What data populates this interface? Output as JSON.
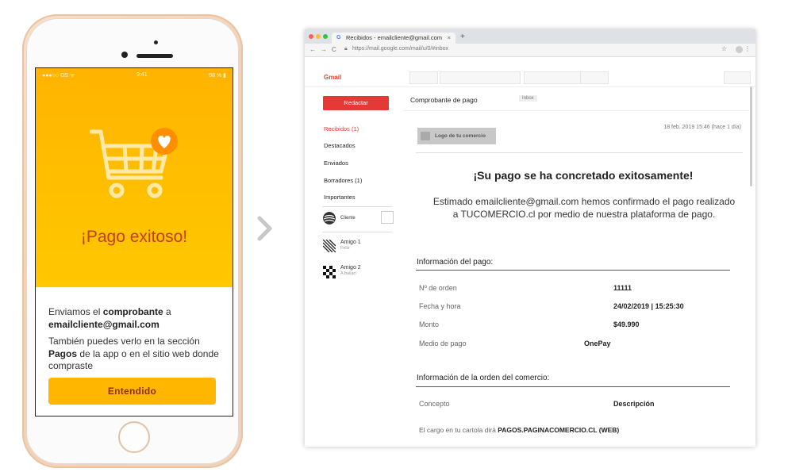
{
  "phone": {
    "status_left": "●●●○○ OS ᯤ",
    "status_time": "9:41",
    "status_right": "58 % ▮",
    "title": "¡Pago exitoso!",
    "msg_line1_pre": "Enviamos el ",
    "msg_line1_bold": "comprobante",
    "msg_line1_post": " a",
    "msg_email": "emailcliente@gmail.com",
    "msg2_pre": "También puedes verlo en la  sección ",
    "msg2_bold": "Pagos",
    "msg2_post": " de la app o en el sitio web donde compraste",
    "button": "Entendido"
  },
  "browser": {
    "tab_title": "Recibidos - emailcliente@gmail.com",
    "tab_close": "×",
    "new_tab": "+",
    "url": "https://mail.google.com/mail/u/0/#inbox",
    "nav_back": "←",
    "nav_forward": "→",
    "nav_reload": "C",
    "star": "☆",
    "more": "⋮"
  },
  "gmail": {
    "label": "Gmail",
    "compose": "Redactar",
    "folders": [
      {
        "label": "Recibidos (1)"
      },
      {
        "label": "Destacados"
      },
      {
        "label": "Enviados"
      },
      {
        "label": "Borradores (1)"
      },
      {
        "label": "Importantes"
      }
    ],
    "contacts": [
      {
        "name": "Cliente",
        "sub": ""
      },
      {
        "name": "Amigo 1",
        "sub": "Feliz"
      },
      {
        "name": "Amigo 2",
        "sub": "A bailar!"
      }
    ]
  },
  "email": {
    "subject": "Comprobante de pago",
    "chip": "Inbox",
    "logo": "Logo de tu comercio",
    "date": "18 feb. 2019 15:46 (hace 1 día)",
    "headline": "¡Su pago se ha concretado exitosamente!",
    "paragraph": "Estimado emailcliente@gmail.com hemos confirmado el pago realizado a TUCOMERCIO.cl por medio de nuestra plataforma de pago.",
    "section1_title": "Información del pago:",
    "rows": [
      {
        "label": "Nº de orden",
        "value": "11111"
      },
      {
        "label": "Fecha y hora",
        "value": "24/02/2019 | 15:25:30"
      },
      {
        "label": "Monto",
        "value": "$49.990"
      },
      {
        "label": "Medio de pago",
        "value": "OnePay"
      }
    ],
    "section2_title": "Información de la orden del comercio:",
    "concept_label": "Concepto",
    "concept_value": "Descripción",
    "footnote_pre": "El cargo en tu cartola dirá ",
    "footnote_bold": "PAGOS.PAGINACOMERCIO.CL (WEB)"
  },
  "colors": {
    "accent_yellow": "#ffb600",
    "title_red": "#c43d1a",
    "compose_red": "#e53935"
  }
}
